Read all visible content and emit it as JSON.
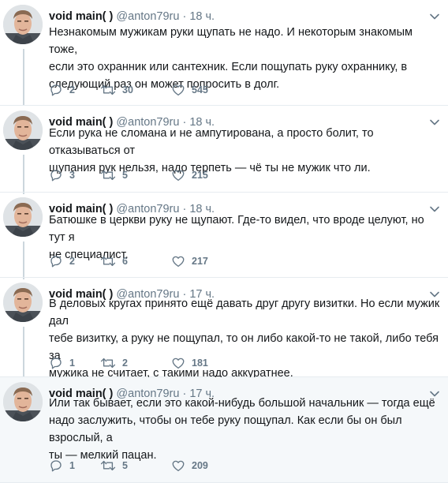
{
  "author": {
    "name": "void main( )",
    "handle": "@anton79ru"
  },
  "tweets": [
    {
      "time": "· 18 ч.",
      "lines": [
        "Незнакомым мужикам руки щупать не надо. И некоторым знакомым тоже,",
        "если это охранник или сантехник. Если пощупать руку охраннику, в",
        "следующий раз он может попросить в долг."
      ],
      "replies": "2",
      "retweets": "30",
      "likes": "545"
    },
    {
      "time": "· 18 ч.",
      "lines": [
        "Если рука не сломана и не ампутирована, а просто болит, то отказываться от",
        "щупания рук нельзя, надо терпеть — чё ты не мужик что ли."
      ],
      "replies": "3",
      "retweets": "5",
      "likes": "215"
    },
    {
      "time": "· 18 ч.",
      "lines": [
        "Батюшке в церкви руку не щупают. Где-то видел, что вроде целуют, но тут я",
        "не специалист."
      ],
      "replies": "2",
      "retweets": "6",
      "likes": "217"
    },
    {
      "time": "· 17 ч.",
      "lines": [
        "В деловых кругах принято ещё давать друг другу визитки. Но если мужик дал",
        "тебе визитку, а руку не пощупал, то он либо какой-то не такой, либо тебя за",
        "мужика не считает, с такими надо аккуратнее."
      ],
      "replies": "1",
      "retweets": "2",
      "likes": "181"
    },
    {
      "time": "· 17 ч.",
      "lines": [
        "Или так бывает, если это какой-нибудь большой начальник — тогда ещё",
        "надо заслужить, чтобы он тебе руку пощупал. Как если бы он был взрослый, а",
        "ты — мелкий пацан."
      ],
      "replies": "1",
      "retweets": "5",
      "likes": "209"
    }
  ]
}
